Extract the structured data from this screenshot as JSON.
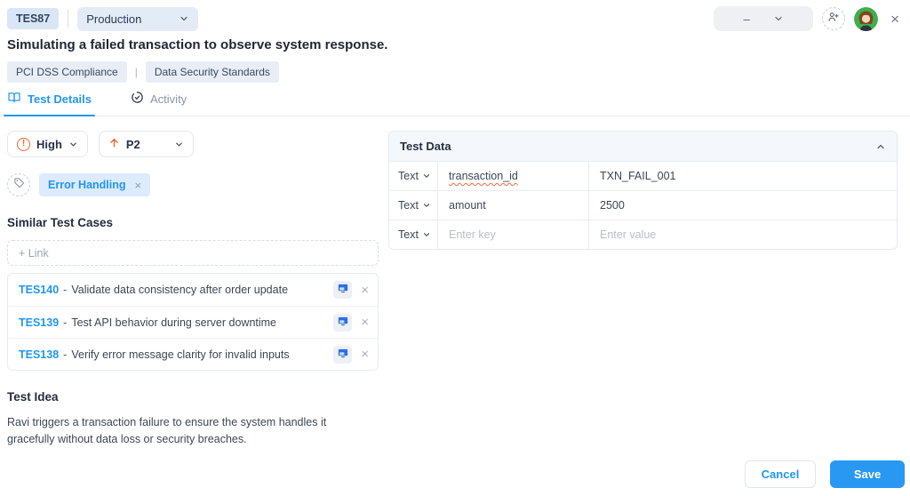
{
  "topbar": {
    "test_id": "TES87",
    "environment": "Production",
    "right_select_value": "–",
    "close_glyph": "×"
  },
  "title": "Simulating a failed transaction to observe system response.",
  "labels": {
    "items": [
      "PCI DSS Compliance",
      "Data Security Standards"
    ],
    "separator": "|"
  },
  "tabs": {
    "test_details": "Test Details",
    "activity": "Activity"
  },
  "attributes": {
    "severity": "High",
    "priority": "P2",
    "severity_icon_glyph": "!"
  },
  "tag_chip": {
    "label": "Error Handling",
    "remove_glyph": "×"
  },
  "similar_test_cases": {
    "heading": "Similar Test Cases",
    "link_placeholder": "+ Link",
    "dash": "-",
    "remove_glyph": "×",
    "items": [
      {
        "id": "TES140",
        "title": "Validate data consistency after order update"
      },
      {
        "id": "TES139",
        "title": "Test API behavior during server downtime"
      },
      {
        "id": "TES138",
        "title": "Verify error message clarity for invalid inputs"
      }
    ]
  },
  "test_idea": {
    "heading": "Test Idea",
    "text": "Ravi triggers a transaction failure to ensure the system handles it gracefully without data loss or security breaches."
  },
  "test_data": {
    "heading": "Test Data",
    "rows": [
      {
        "type": "Text",
        "key": "transaction_id",
        "value": "TXN_FAIL_001"
      },
      {
        "type": "Text",
        "key": "amount",
        "value": "2500"
      },
      {
        "type": "Text",
        "key_placeholder": "Enter key",
        "value_placeholder": "Enter value"
      }
    ]
  },
  "footer": {
    "cancel": "Cancel",
    "save": "Save"
  },
  "colors": {
    "accent": "#2196f3",
    "severity_orange": "#f0662f",
    "chip_bg": "#dcebfd",
    "badge_bg": "#d9e6f7",
    "panel_header_bg": "#f4f8fc"
  }
}
